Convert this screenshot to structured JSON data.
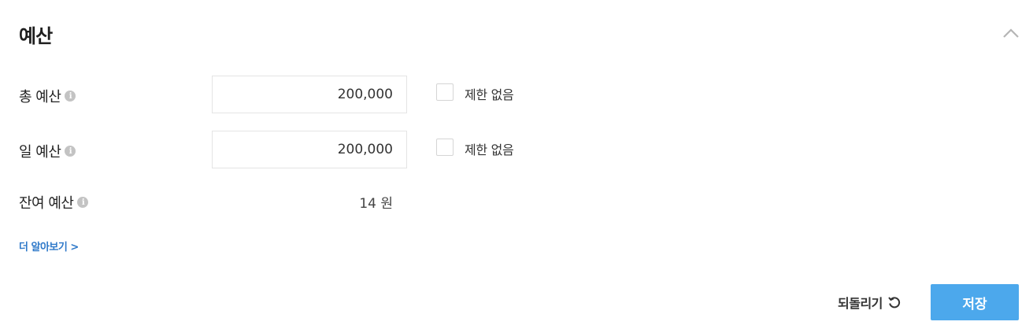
{
  "section": {
    "title": "예산"
  },
  "rows": {
    "total": {
      "label": "총 예산",
      "value": "200,000",
      "no_limit_label": "제한 없음"
    },
    "daily": {
      "label": "일 예산",
      "value": "200,000",
      "no_limit_label": "제한 없음"
    },
    "remaining": {
      "label": "잔여 예산",
      "value": "14 원"
    }
  },
  "links": {
    "learn_more": "더 알아보기 >"
  },
  "actions": {
    "revert_label": "되돌리기",
    "save_label": "저장"
  },
  "icons": {
    "collapse": "chevron-up-icon",
    "info": "info-icon",
    "revert": "undo-icon"
  },
  "colors": {
    "accent": "#4ca8ec",
    "link": "#2f79c9"
  }
}
